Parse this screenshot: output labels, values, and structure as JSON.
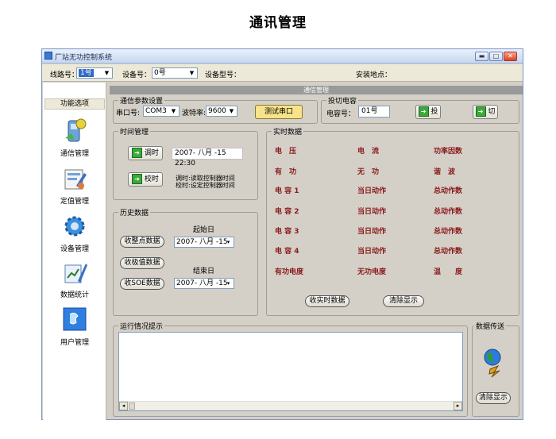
{
  "page_title": "通讯管理",
  "window": {
    "title": "厂站无功控制系统",
    "controls": {
      "minimize": "▬",
      "maximize": "□",
      "close": "✕"
    }
  },
  "toolbar": {
    "line_label": "线路号：",
    "line_value": "1号",
    "device_label": "设备号：",
    "device_value": "0号",
    "device_type_label": "设备型号：",
    "install_label": "安装地点："
  },
  "sidebar": {
    "header": "功能选项",
    "items": [
      {
        "label": "通信管理",
        "icon": "phone-icon"
      },
      {
        "label": "定值管理",
        "icon": "settings-doc-icon"
      },
      {
        "label": "设备管理",
        "icon": "gear-icon"
      },
      {
        "label": "数据统计",
        "icon": "chart-pen-icon"
      },
      {
        "label": "用户管理",
        "icon": "user-icon"
      }
    ]
  },
  "main": {
    "header": "通信管理",
    "comm_params": {
      "title": "通信参数设置",
      "port_label": "串口号:",
      "port_value": "COM3",
      "baud_label": "波特率:",
      "baud_value": "9600",
      "test_button": "测试串口"
    },
    "switching": {
      "title": "投切电容",
      "cap_label": "电容号：",
      "cap_value": "01号",
      "on_button": "投",
      "off_button": "切"
    },
    "time_mgmt": {
      "title": "时间管理",
      "read_button": "调时",
      "read_value": "2007- 八月 -15 22:30",
      "set_button": "校时",
      "note_line1": "调时:读取控制器时间",
      "note_line2": "校时:设定控制器时间"
    },
    "history": {
      "title": "历史数据",
      "start_label": "起始日",
      "end_label": "结束日",
      "btn_points": "收整点数据",
      "btn_extremes": "收极值数据",
      "btn_soe": "收SOE数据",
      "start_date": "2007- 八月 -15",
      "end_date": "2007- 八月 -15"
    },
    "realtime": {
      "title": "实时数据",
      "rows": [
        [
          "电　压",
          "电　流",
          "功率因数"
        ],
        [
          "有　功",
          "无　功",
          "谐　波"
        ],
        [
          "电 容 1",
          "当日动作",
          "总动作数"
        ],
        [
          "电 容 2",
          "当日动作",
          "总动作数"
        ],
        [
          "电 容 3",
          "当日动作",
          "总动作数"
        ],
        [
          "电 容 4",
          "当日动作",
          "总动作数"
        ],
        [
          "有功电度",
          "无功电度",
          "温　　度"
        ]
      ],
      "collect_button": "收实时数据",
      "clear_button": "清除显示"
    },
    "log": {
      "title": "运行情况提示",
      "scroll_left": "◂",
      "scroll_right": "▸"
    },
    "transfer": {
      "title": "数据传送",
      "clear_button": "清除显示"
    }
  },
  "colors": {
    "window_bg": "#d4d0c8",
    "realtime_text": "#8b1a1a",
    "header_bar": "#9a9a9a",
    "accent_blue": "#316ac5"
  }
}
